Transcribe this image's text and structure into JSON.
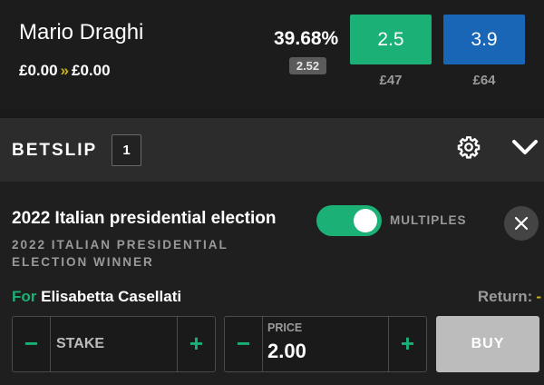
{
  "market": {
    "runner_name": "Mario Draghi",
    "pl_from": "£0.00",
    "pl_arrow": "»",
    "pl_to": "£0.00",
    "probability": "39.68%",
    "last_traded": "2.52",
    "back_odds": "2.5",
    "lay_odds": "3.9",
    "back_liquidity": "£47",
    "lay_liquidity": "£64",
    "colors": {
      "back": "#1bb176",
      "lay": "#1a66b6"
    }
  },
  "betslip": {
    "title": "BETSLIP",
    "count": "1",
    "icons": {
      "settings": "gear-icon",
      "collapse": "chevron-down-icon"
    }
  },
  "bet": {
    "event_title": "2022 Italian presidential election",
    "market_name": "2022 ITALIAN PRESIDENTIAL ELECTION WINNER",
    "multiples_label": "MULTIPLES",
    "multiples_on": true,
    "for_label": "For",
    "selection": "Elisabetta Casellati",
    "return_label": "Return:",
    "return_value": "-",
    "stake_placeholder": "STAKE",
    "minus_label": "−",
    "plus_label": "+",
    "price_label": "PRICE",
    "price_value": "2.00",
    "buy_label": "BUY"
  }
}
